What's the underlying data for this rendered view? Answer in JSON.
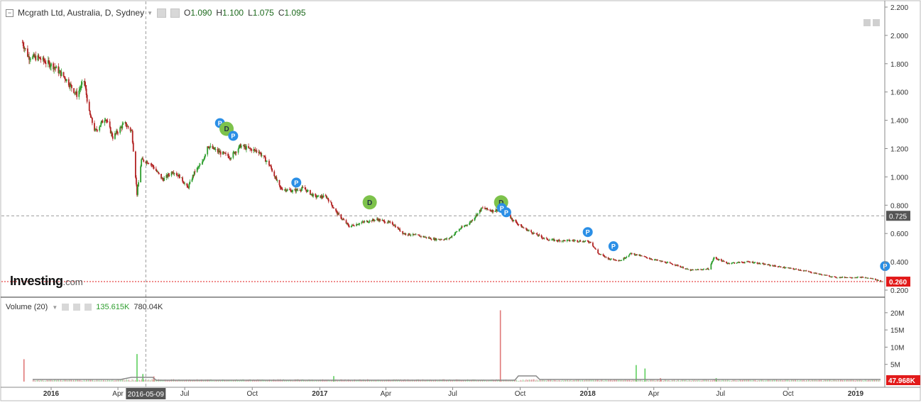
{
  "legend": {
    "symbol": "Mcgrath Ltd, Australia, D, Sydney",
    "open_label": "O",
    "open": "1.090",
    "high_label": "H",
    "high": "1.100",
    "low_label": "L",
    "low": "1.075",
    "close_label": "C",
    "close": "1.095"
  },
  "volume_legend": {
    "title": "Volume (20)",
    "value1": "135.615K",
    "value2": "780.04K"
  },
  "brand": {
    "name": "Investing",
    "suffix": ".com"
  },
  "price_axis": {
    "ticks": [
      "2.200",
      "2.000",
      "1.800",
      "1.600",
      "1.400",
      "1.200",
      "1.000",
      "0.800",
      "0.600",
      "0.400",
      "0.200"
    ],
    "crosshair_label": "0.725",
    "last_price_label": "0.260"
  },
  "volume_axis": {
    "ticks": [
      "20M",
      "15M",
      "10M",
      "5M"
    ],
    "last_label": "47.968K"
  },
  "time_axis": {
    "ticks": [
      "2016",
      "Apr",
      "Jul",
      "Oct",
      "2017",
      "Apr",
      "Jul",
      "Oct",
      "2018",
      "Apr",
      "Jul",
      "Oct",
      "2019"
    ],
    "crosshair_date": "2016-05-09"
  },
  "colors": {
    "up": "#2e9e2e",
    "down": "#b22222",
    "dividend_marker": "#7dc24b",
    "p_marker": "#2b8fe6",
    "last_price_line": "#e21a1a",
    "crosshair_label_bg": "#555555"
  },
  "chart_data": {
    "type": "candlestick",
    "title": "Mcgrath Ltd, Australia, D, Sydney",
    "ylim": [
      0.2,
      2.2
    ],
    "x_range": [
      "2015-11-23",
      "2019-02-28"
    ],
    "price_path": [
      [
        "2015-11-23",
        1.95
      ],
      [
        "2015-12-01",
        1.85
      ],
      [
        "2015-12-15",
        1.84
      ],
      [
        "2016-01-05",
        1.78
      ],
      [
        "2016-01-20",
        1.7
      ],
      [
        "2016-02-05",
        1.58
      ],
      [
        "2016-02-15",
        1.68
      ],
      [
        "2016-02-22",
        1.45
      ],
      [
        "2016-03-01",
        1.32
      ],
      [
        "2016-03-15",
        1.42
      ],
      [
        "2016-03-25",
        1.28
      ],
      [
        "2016-04-10",
        1.38
      ],
      [
        "2016-04-20",
        1.32
      ],
      [
        "2016-04-27",
        0.88
      ],
      [
        "2016-05-03",
        1.12
      ],
      [
        "2016-05-15",
        1.1
      ],
      [
        "2016-06-01",
        0.98
      ],
      [
        "2016-06-15",
        1.04
      ],
      [
        "2016-06-25",
        1.0
      ],
      [
        "2016-07-05",
        0.92
      ],
      [
        "2016-07-15",
        1.04
      ],
      [
        "2016-07-25",
        1.1
      ],
      [
        "2016-08-01",
        1.22
      ],
      [
        "2016-08-15",
        1.18
      ],
      [
        "2016-09-01",
        1.14
      ],
      [
        "2016-09-15",
        1.22
      ],
      [
        "2016-09-25",
        1.2
      ],
      [
        "2016-10-10",
        1.18
      ],
      [
        "2016-10-25",
        1.08
      ],
      [
        "2016-11-08",
        0.92
      ],
      [
        "2016-11-25",
        0.9
      ],
      [
        "2016-12-10",
        0.92
      ],
      [
        "2016-12-25",
        0.86
      ],
      [
        "2017-01-10",
        0.86
      ],
      [
        "2017-01-25",
        0.74
      ],
      [
        "2017-02-10",
        0.65
      ],
      [
        "2017-03-01",
        0.68
      ],
      [
        "2017-03-20",
        0.7
      ],
      [
        "2017-04-10",
        0.67
      ],
      [
        "2017-04-25",
        0.6
      ],
      [
        "2017-05-20",
        0.58
      ],
      [
        "2017-06-05",
        0.56
      ],
      [
        "2017-06-25",
        0.56
      ],
      [
        "2017-07-10",
        0.63
      ],
      [
        "2017-07-25",
        0.68
      ],
      [
        "2017-08-10",
        0.78
      ],
      [
        "2017-08-25",
        0.76
      ],
      [
        "2017-09-08",
        0.78
      ],
      [
        "2017-09-20",
        0.7
      ],
      [
        "2017-10-05",
        0.64
      ],
      [
        "2017-10-20",
        0.6
      ],
      [
        "2017-11-05",
        0.56
      ],
      [
        "2017-11-20",
        0.55
      ],
      [
        "2017-12-15",
        0.55
      ],
      [
        "2018-01-05",
        0.54
      ],
      [
        "2018-01-15",
        0.46
      ],
      [
        "2018-01-30",
        0.42
      ],
      [
        "2018-02-15",
        0.41
      ],
      [
        "2018-03-01",
        0.46
      ],
      [
        "2018-03-15",
        0.44
      ],
      [
        "2018-04-05",
        0.41
      ],
      [
        "2018-04-30",
        0.38
      ],
      [
        "2018-05-20",
        0.34
      ],
      [
        "2018-06-15",
        0.35
      ],
      [
        "2018-06-22",
        0.43
      ],
      [
        "2018-07-10",
        0.39
      ],
      [
        "2018-08-10",
        0.4
      ],
      [
        "2018-09-01",
        0.38
      ],
      [
        "2018-09-25",
        0.36
      ],
      [
        "2018-10-20",
        0.34
      ],
      [
        "2018-11-15",
        0.31
      ],
      [
        "2018-12-05",
        0.29
      ],
      [
        "2018-12-20",
        0.29
      ],
      [
        "2019-01-10",
        0.29
      ],
      [
        "2019-01-25",
        0.28
      ],
      [
        "2019-02-05",
        0.26
      ]
    ],
    "events": [
      {
        "type": "P",
        "date": "2016-08-18",
        "price": 1.38
      },
      {
        "type": "D",
        "date": "2016-08-27",
        "price": 1.34
      },
      {
        "type": "P",
        "date": "2016-09-05",
        "price": 1.29
      },
      {
        "type": "P",
        "date": "2016-11-30",
        "price": 0.96
      },
      {
        "type": "D",
        "date": "2017-03-10",
        "price": 0.82
      },
      {
        "type": "D",
        "date": "2017-09-05",
        "price": 0.82
      },
      {
        "type": "P",
        "date": "2017-09-06",
        "price": 0.78
      },
      {
        "type": "P",
        "date": "2017-09-12",
        "price": 0.75
      },
      {
        "type": "P",
        "date": "2018-01-01",
        "price": 0.61
      },
      {
        "type": "P",
        "date": "2018-02-05",
        "price": 0.51
      },
      {
        "type": "P",
        "date": "2019-02-10",
        "price": 0.37
      }
    ],
    "volume_ylim": [
      0,
      21
    ],
    "volume_spikes_m": [
      [
        "2015-11-25",
        6.5,
        "down"
      ],
      [
        "2016-04-27",
        8.0,
        "up"
      ],
      [
        "2016-05-05",
        2.2,
        "up"
      ],
      [
        "2016-05-20",
        1.5,
        "down"
      ],
      [
        "2017-01-20",
        1.6,
        "up"
      ],
      [
        "2017-09-04",
        20.7,
        "down"
      ],
      [
        "2018-03-08",
        4.8,
        "up"
      ],
      [
        "2018-03-20",
        3.8,
        "up"
      ],
      [
        "2018-04-10",
        1.0,
        "down"
      ],
      [
        "2018-06-25",
        1.0,
        "up"
      ]
    ]
  }
}
